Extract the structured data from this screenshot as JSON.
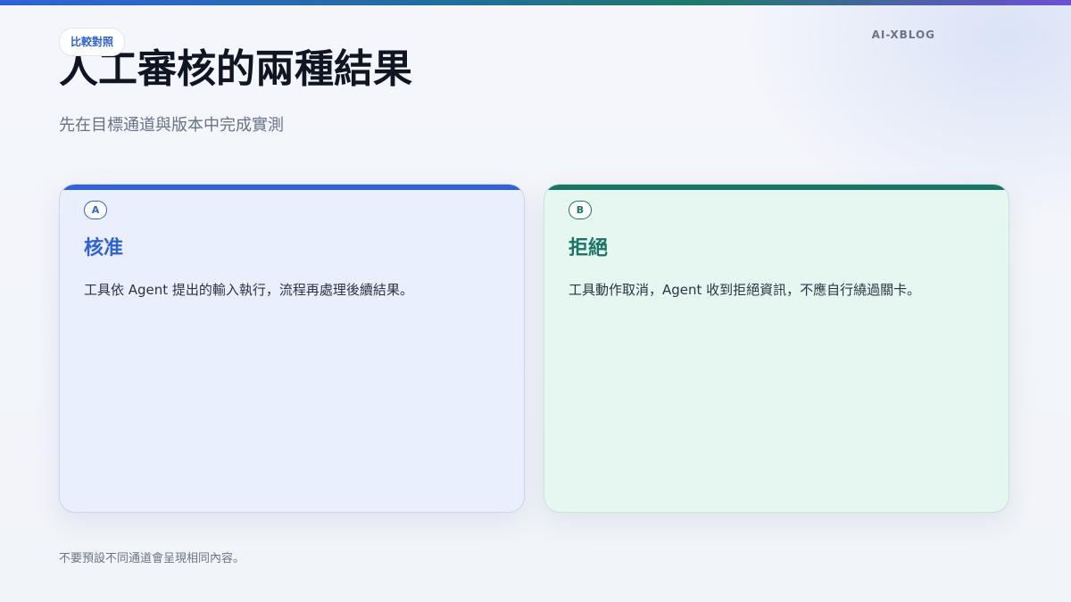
{
  "brand": "AI-XBLOG",
  "tag": "比較對照",
  "title": "人工審核的兩種結果",
  "subtitle": "先在目標通道與版本中完成實測",
  "cards": [
    {
      "badge": "A",
      "title": "核准",
      "text": "工具依 Agent 提出的輸入執行，流程再處理後續結果。",
      "accent": "#2f62d8"
    },
    {
      "badge": "B",
      "title": "拒絕",
      "text": "工具動作取消，Agent 收到拒絕資訊，不應自行繞過關卡。",
      "accent": "#1a7566"
    }
  ],
  "footnote": "不要預設不同通道會呈現相同內容。"
}
